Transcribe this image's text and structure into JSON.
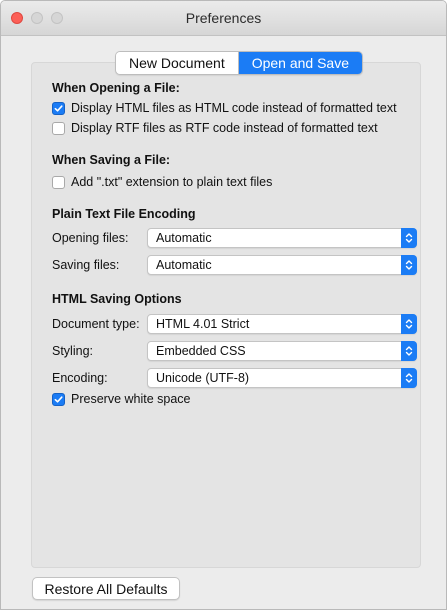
{
  "window": {
    "title": "Preferences"
  },
  "tabs": [
    {
      "label": "New Document",
      "active": false
    },
    {
      "label": "Open and Save",
      "active": true
    }
  ],
  "opening": {
    "heading": "When Opening a File:",
    "options": [
      {
        "label": "Display HTML files as HTML code instead of formatted text",
        "checked": true
      },
      {
        "label": "Display RTF files as RTF code instead of formatted text",
        "checked": false
      }
    ]
  },
  "saving": {
    "heading": "When Saving a File:",
    "options": [
      {
        "label": "Add \".txt\" extension to plain text files",
        "checked": false
      }
    ]
  },
  "encoding": {
    "heading": "Plain Text File Encoding",
    "opening_label": "Opening files:",
    "opening_value": "Automatic",
    "saving_label": "Saving files:",
    "saving_value": "Automatic"
  },
  "html_saving": {
    "heading": "HTML Saving Options",
    "doctype_label": "Document type:",
    "doctype_value": "HTML 4.01 Strict",
    "styling_label": "Styling:",
    "styling_value": "Embedded CSS",
    "encoding_label": "Encoding:",
    "encoding_value": "Unicode (UTF-8)",
    "preserve_label": "Preserve white space",
    "preserve_checked": true
  },
  "footer": {
    "restore_label": "Restore All Defaults"
  },
  "colors": {
    "accent": "#1b7cf5",
    "close": "#fc5f57",
    "panel": "#e4e4e4",
    "window": "#ececec"
  },
  "icons": [
    "close-window-icon",
    "minimize-window-icon",
    "zoom-window-icon",
    "checkmark-icon",
    "updown-chevron-icon"
  ]
}
